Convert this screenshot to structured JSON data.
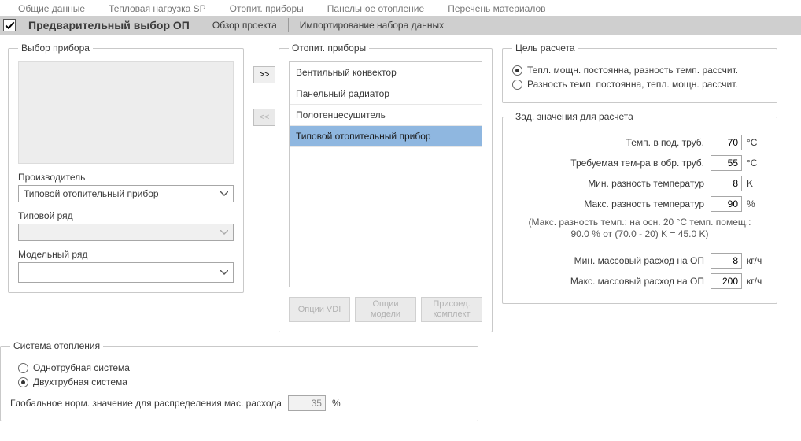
{
  "topTabs": {
    "t0": "Общие данные",
    "t1": "Тепловая нагрузка SP",
    "t2": "Отопит. приборы",
    "t3": "Панельное отопление",
    "t4": "Перечень материалов"
  },
  "toolbar": {
    "preselect": "Предварительный выбор ОП",
    "overview": "Обзор проекта",
    "import": "Импортирование набора данных"
  },
  "deviceSelect": {
    "legend": "Выбор прибора",
    "manufacturer_label": "Производитель",
    "manufacturer_value": "Типовой отопительный прибор",
    "type_series_label": "Типовой ряд",
    "type_series_value": "",
    "model_series_label": "Модельный ряд",
    "model_series_value": ""
  },
  "xfer": {
    "right": ">>",
    "left": "<<"
  },
  "heaters": {
    "legend": "Отопит. приборы",
    "items": {
      "i0": "Вентильный конвектор",
      "i1": "Панельный радиатор",
      "i2": "Полотенцесушитель",
      "i3": "Типовой отопительный прибор"
    },
    "btn_vdi": "Опции VDI",
    "btn_model": "Опции модели",
    "btn_conn": "Присоед. комплект"
  },
  "goal": {
    "legend": "Цель расчета",
    "opt1": "Тепл. мощн. постоянна, разность темп. рассчит.",
    "opt2": "Разность темп. постоянна, тепл. мощн. рассчит."
  },
  "setpoints": {
    "legend": "Зад. значения для расчета",
    "supply_label": "Темп. в под. труб.",
    "supply_value": "70",
    "supply_unit": "°C",
    "return_label": "Требуемая тем-ра в обр. труб.",
    "return_value": "55",
    "return_unit": "°C",
    "dt_min_label": "Мин. разность температур",
    "dt_min_value": "8",
    "dt_min_unit": "K",
    "dt_max_label": "Макс. разность температур",
    "dt_max_value": "90",
    "dt_max_unit": "%",
    "note1": "(Макс. разность темп.: на осн. 20 °C темп. помещ.:",
    "note2": "90.0 % от (70.0 - 20) K = 45.0 K)",
    "mmin_label": "Мин. массовый расход на ОП",
    "mmin_value": "8",
    "mmin_unit": "кг/ч",
    "mmax_label": "Макс. массовый расход на ОП",
    "mmax_value": "200",
    "mmax_unit": "кг/ч"
  },
  "system": {
    "legend": "Система отопления",
    "opt1": "Однотрубная система",
    "opt2": "Двухтрубная система",
    "global_label": "Глобальное норм. значение для распределения мас. расхода",
    "global_value": "35",
    "global_unit": "%"
  }
}
